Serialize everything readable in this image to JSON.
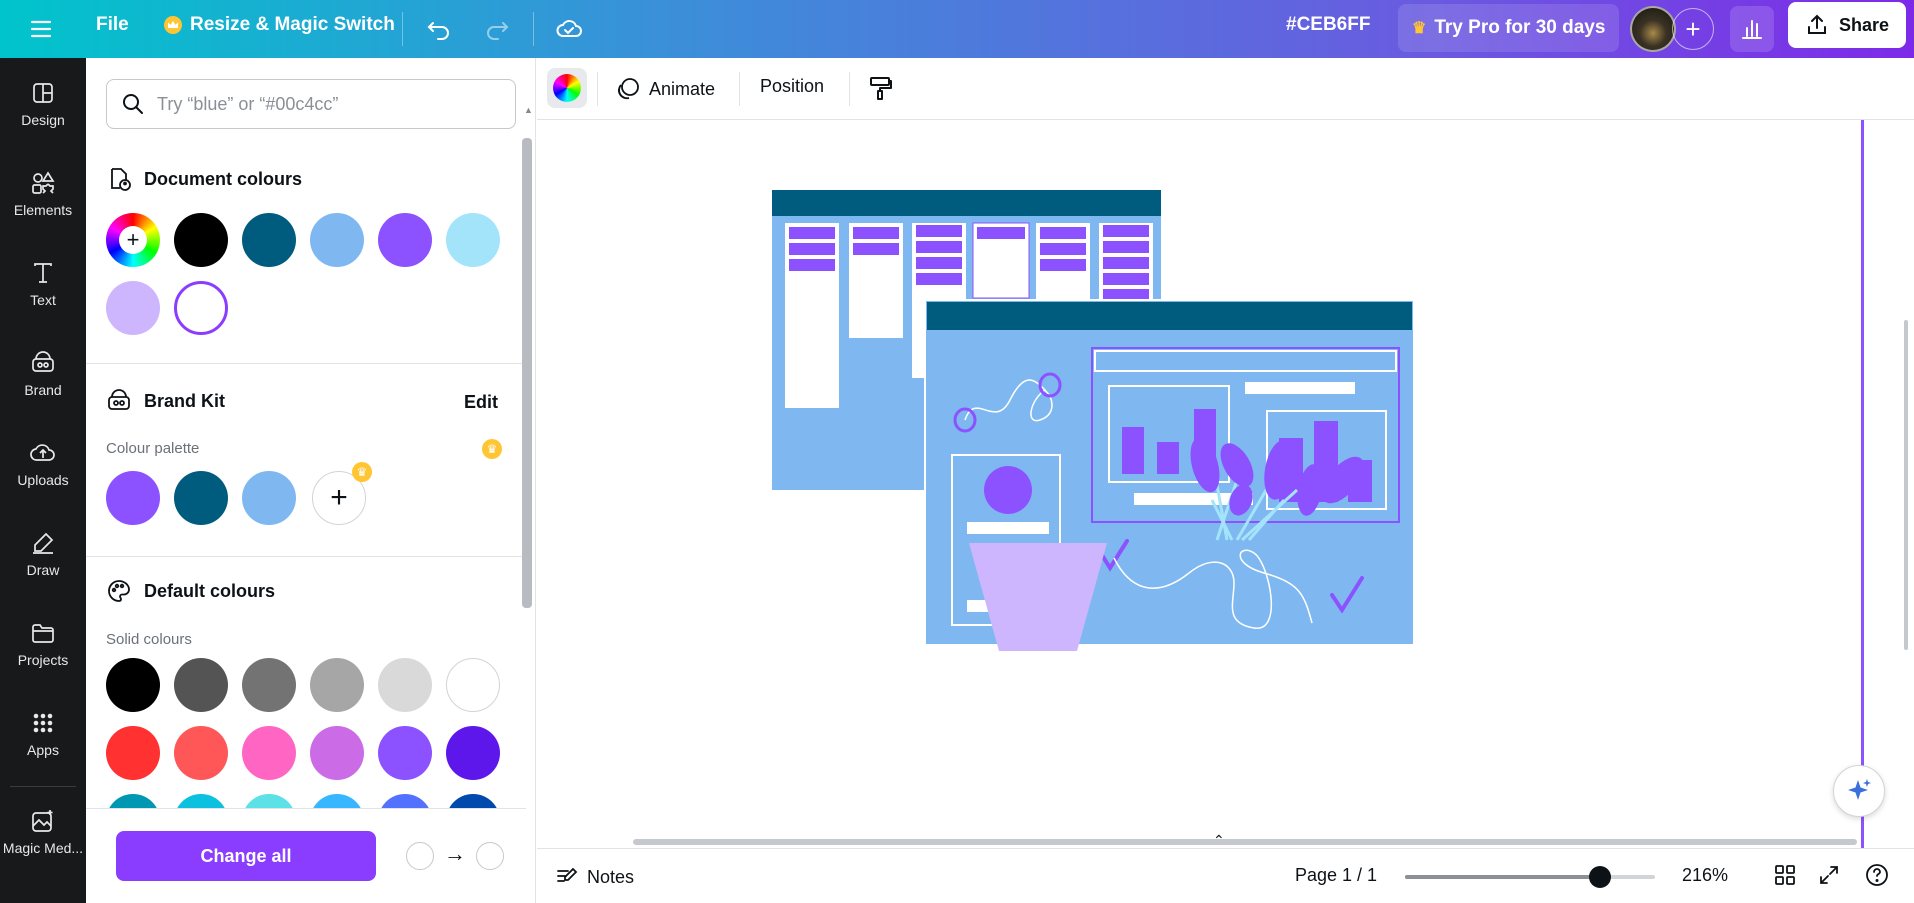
{
  "topbar": {
    "file_label": "File",
    "resize_label": "Resize & Magic Switch",
    "color_hex": "#CEB6FF",
    "pro_label": "Try Pro for 30 days",
    "share_label": "Share"
  },
  "sidebar": {
    "items": [
      {
        "label": "Design",
        "icon": "design-icon"
      },
      {
        "label": "Elements",
        "icon": "elements-icon"
      },
      {
        "label": "Text",
        "icon": "text-icon"
      },
      {
        "label": "Brand",
        "icon": "brand-icon"
      },
      {
        "label": "Uploads",
        "icon": "uploads-icon"
      },
      {
        "label": "Draw",
        "icon": "draw-icon"
      },
      {
        "label": "Projects",
        "icon": "projects-icon"
      },
      {
        "label": "Apps",
        "icon": "apps-icon"
      },
      {
        "label": "Magic Med...",
        "icon": "magic-media-icon"
      }
    ]
  },
  "panel": {
    "search_placeholder": "Try “blue” or “#00c4cc”",
    "document_colours_title": "Document colours",
    "document_colours": [
      "#000000",
      "#005c7e",
      "#7fb8f0",
      "#8c52ff",
      "#a3e4fb",
      "#ceb6ff",
      "#ffffff"
    ],
    "brand_kit_title": "Brand Kit",
    "brand_kit_edit": "Edit",
    "colour_palette_label": "Colour palette",
    "brand_colours": [
      "#8c52ff",
      "#005c7e",
      "#7fb8f0"
    ],
    "default_colours_title": "Default colours",
    "solid_colours_label": "Solid colours",
    "solid_colours_row1": [
      "#000000",
      "#545454",
      "#737373",
      "#a6a6a6",
      "#d9d9d9",
      "#ffffff"
    ],
    "solid_colours_row2": [
      "#ff3131",
      "#ff5757",
      "#ff66c4",
      "#cb6ce6",
      "#8c52ff",
      "#5e17eb"
    ],
    "solid_colours_row3": [
      "#0097b2",
      "#0cc0df",
      "#5ce1e6",
      "#38b6ff",
      "#5271ff",
      "#004aad"
    ],
    "change_all_label": "Change all"
  },
  "context_bar": {
    "animate_label": "Animate",
    "position_label": "Position"
  },
  "bottom_bar": {
    "notes_label": "Notes",
    "page_label": "Page 1 / 1",
    "zoom_label": "216%",
    "zoom_level_fraction": 0.78
  },
  "colors": {
    "accent": "#8b3dff",
    "dark_teal": "#005c7e",
    "light_blue": "#7fb8f0",
    "purple": "#8c52ff",
    "lavender": "#ceb6ff"
  }
}
